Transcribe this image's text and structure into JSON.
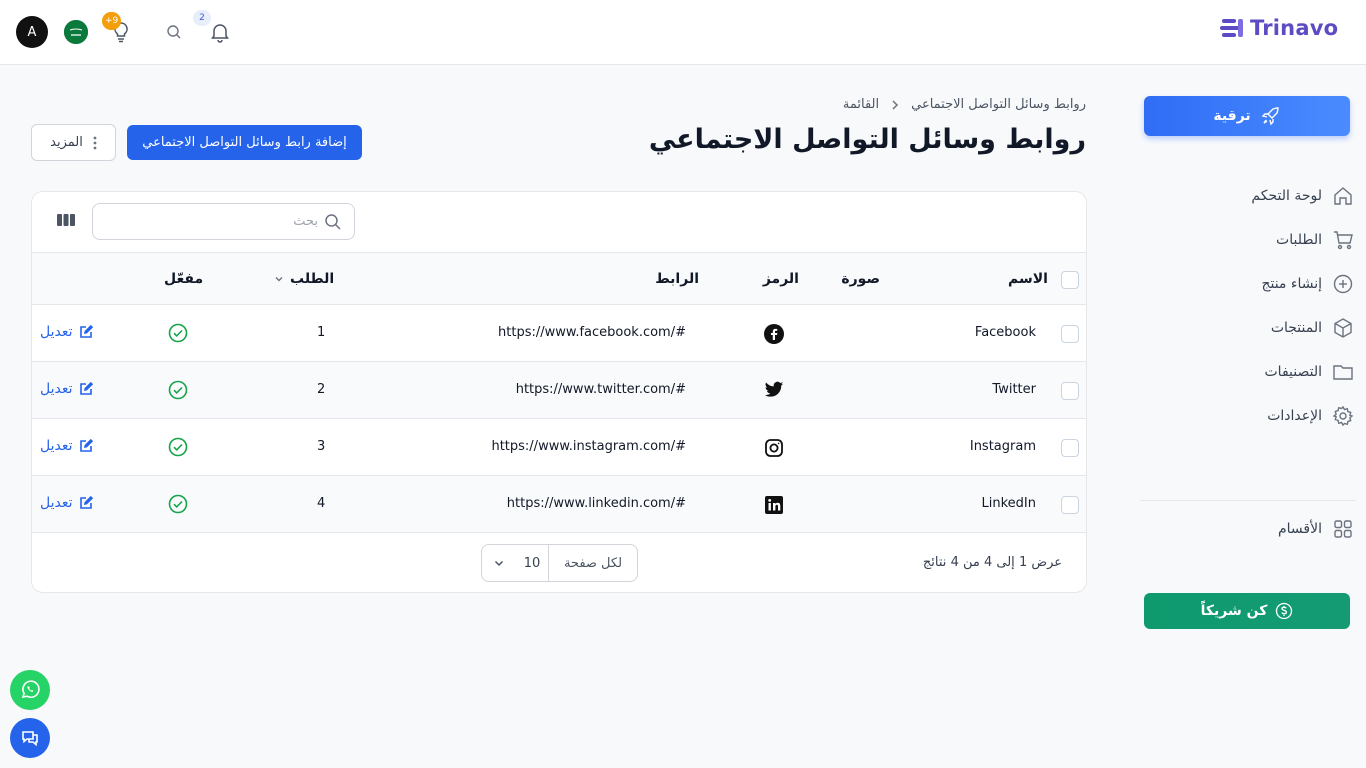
{
  "colors": {
    "primary": "#2563eb",
    "brand": "#5b4cc4",
    "success": "#16a34a",
    "partner": "#0f9a6e",
    "whatsapp": "#25d366"
  },
  "topbar": {
    "logo_text": "Trinavo",
    "avatar_initial": "A",
    "bulb_badge": "+9",
    "notifications_badge": "2"
  },
  "sidebar": {
    "upgrade_label": "ترقية",
    "items": [
      {
        "label": "لوحة التحكم",
        "icon": "home-icon"
      },
      {
        "label": "الطلبات",
        "icon": "cart-icon"
      },
      {
        "label": "إنشاء منتج",
        "icon": "plus-circle-icon"
      },
      {
        "label": "المنتجات",
        "icon": "box-icon"
      },
      {
        "label": "التصنيفات",
        "icon": "folder-icon"
      },
      {
        "label": "الإعدادات",
        "icon": "gear-icon"
      }
    ],
    "sections_label": "الأقسام",
    "partner_label": "كن شريكاً"
  },
  "breadcrumb": {
    "parent": "القائمة",
    "current": "روابط وسائل التواصل الاجتماعي"
  },
  "page_title": "روابط وسائل التواصل الاجتماعي",
  "actions": {
    "add_label": "إضافة رابط وسائل التواصل الاجتماعي",
    "more_label": "المزيد"
  },
  "table": {
    "search_placeholder": "بحث",
    "headers": {
      "name": "الاسم",
      "image": "صورة",
      "symbol": "الرمز",
      "link": "الرابط",
      "order": "الطلب",
      "enabled": "مفعّل"
    },
    "rows": [
      {
        "name": "Facebook",
        "icon": "facebook-icon",
        "link": "https://www.facebook.com/#",
        "order": "1",
        "enabled": true,
        "edit": "تعديل"
      },
      {
        "name": "Twitter",
        "icon": "twitter-icon",
        "link": "https://www.twitter.com/#",
        "order": "2",
        "enabled": true,
        "edit": "تعديل"
      },
      {
        "name": "Instagram",
        "icon": "instagram-icon",
        "link": "https://www.instagram.com/#",
        "order": "3",
        "enabled": true,
        "edit": "تعديل"
      },
      {
        "name": "LinkedIn",
        "icon": "linkedin-icon",
        "link": "https://www.linkedin.com/#",
        "order": "4",
        "enabled": true,
        "edit": "تعديل"
      }
    ],
    "footer_summary": "عرض 1 إلى 4 من 4 نتائج",
    "per_page_label": "لكل صفحة",
    "per_page_value": "10"
  }
}
